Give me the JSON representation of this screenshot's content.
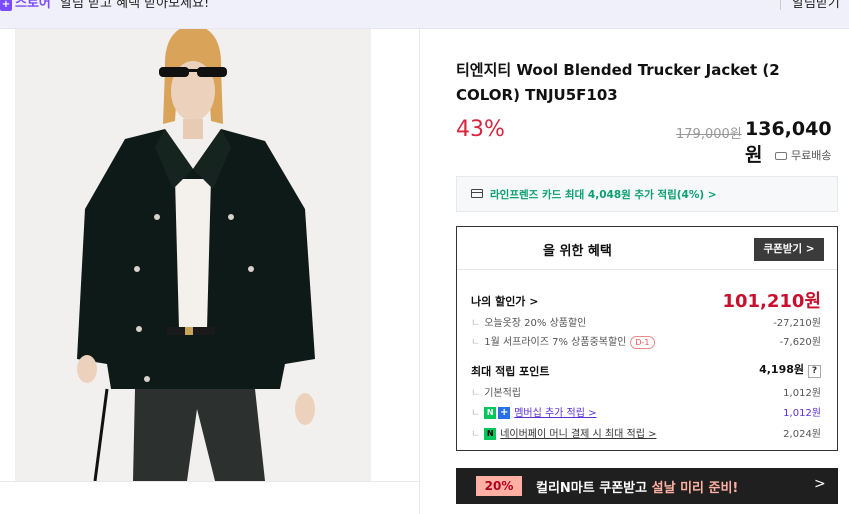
{
  "topbar": {
    "badge": "스토어",
    "message": "알림 받고 혜택 받아보세요!",
    "alarm_button": "알림받기"
  },
  "product": {
    "title": "티엔지티 Wool Blended Trucker Jacket (2 COLOR) TNJU5F103",
    "discount_rate": "43%",
    "original_price": "179,000원",
    "sale_price": "136,040원",
    "shipping": "무료배송",
    "image_alt": "Model wearing a dark green wool trucker jacket"
  },
  "card_promo": {
    "text": "라인프렌즈 카드 최대 4,048원 추가 적립(4%) >"
  },
  "benefit": {
    "title": "을 위한 혜택",
    "coupon_button": "쿠폰받기 >",
    "my_price_label": "나의 할인가 >",
    "my_price_value": "101,210원",
    "discounts": [
      {
        "label": "오늘옷장 20% 상품할인",
        "value": "-27,210원",
        "badge": ""
      },
      {
        "label": "1월 서프라이즈 7% 상품중복할인",
        "value": "-7,620원",
        "badge": "D-1"
      }
    ],
    "points_label": "최대 적립 포인트",
    "points_value": "4,198원",
    "points_help": "?",
    "points": [
      {
        "label": "기본적립",
        "value": "1,012원"
      },
      {
        "label": "멤버십 추가 적립 >",
        "value": "1,012원"
      },
      {
        "label": "네이버페이 머니 결제 시 최대 적립 >",
        "value": "2,024원"
      }
    ]
  },
  "banner": {
    "badge": "20%",
    "text_main": "컬리N마트 쿠폰받고 ",
    "text_highlight": "설날 미리 준비!",
    "arrow": ">"
  },
  "colors": {
    "accent_purple": "#7b4bff",
    "discount_red": "#d7263d",
    "naver_green": "#03c75a",
    "banner_pink": "#ffb0a2"
  }
}
